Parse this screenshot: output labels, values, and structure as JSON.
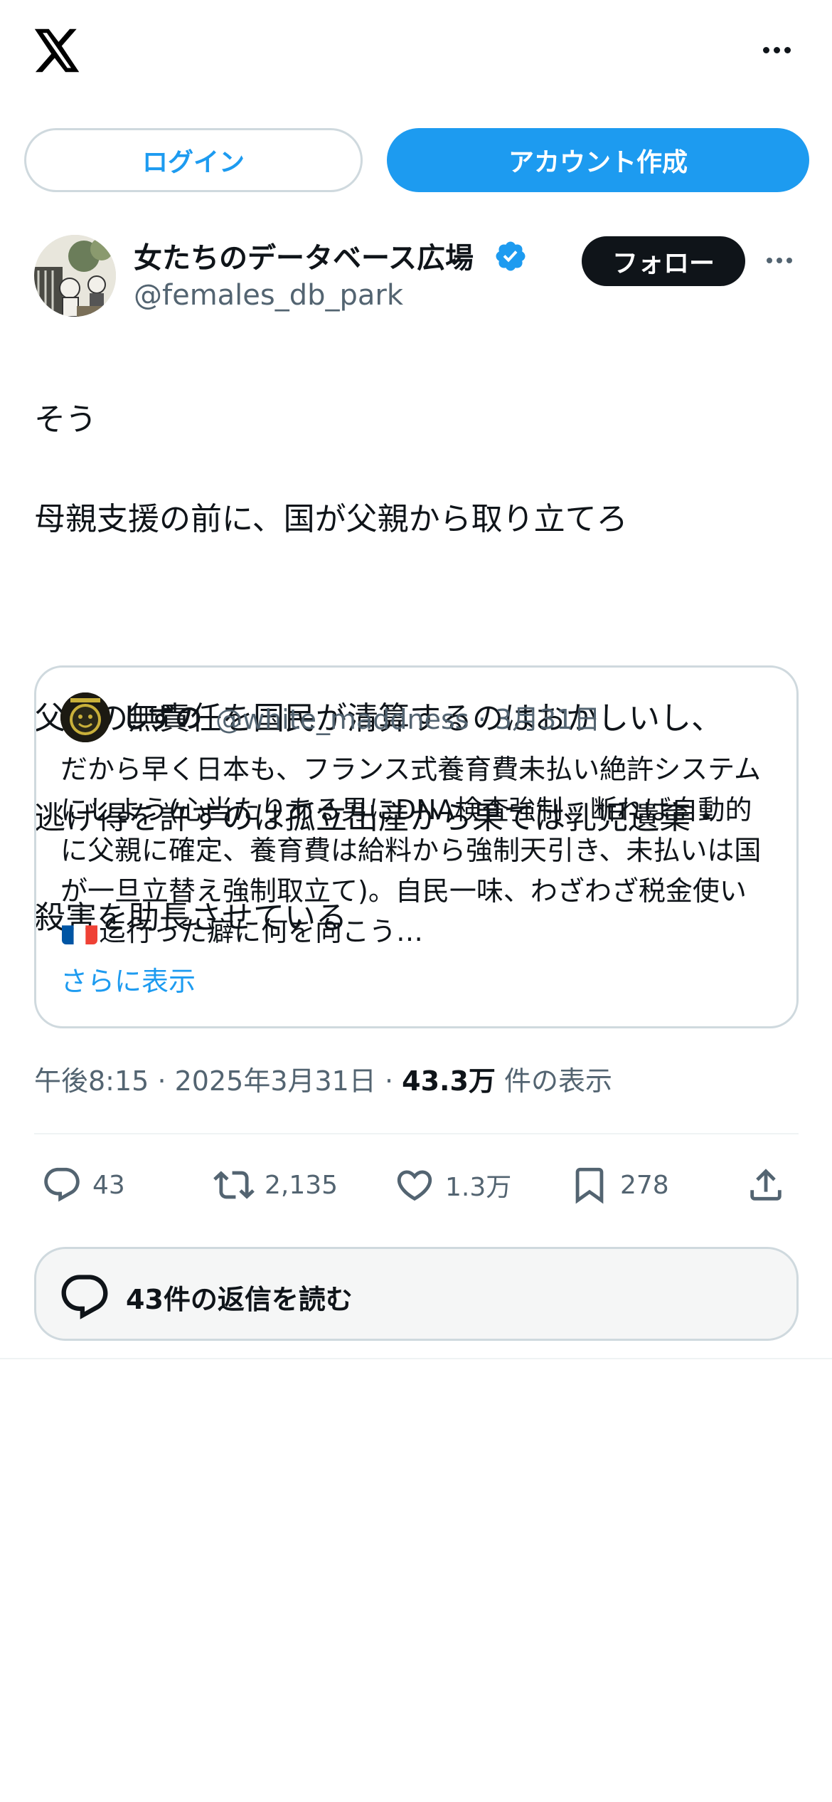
{
  "header": {
    "logo": "x-logo-icon",
    "more_icon": "more-horizontal-icon"
  },
  "auth": {
    "login_label": "ログイン",
    "signup_label": "アカウント作成"
  },
  "author": {
    "name": "女たちのデータベース広場",
    "handle": "@females_db_park",
    "verified_icon": "verified-badge-icon",
    "follow_label": "フォロー"
  },
  "tweet": {
    "line1": "そう",
    "line2": "母親支援の前に、国が父親から取り立てろ",
    "line3": "父親の無責任を国民が清算するのはおかしいし、",
    "line4": "逃げ得を許すのは孤立出産から果ては乳児遺棄・",
    "line5": "殺害を助長させている"
  },
  "quote": {
    "name": "しずの",
    "handle": "@white_maddness",
    "date": "3月31日",
    "separator": "·",
    "text_before_flag": "だから早く日本も、フランス式養育費未払い絶許システムにしよう(心当たりある男にDNA検査強制、断れば自動的に父親に確定、養育費は給料から強制天引き、未払いは国が一旦立替え強制取立て)。自民一味、わざわざ税金使い",
    "flag_icon": "france-flag-icon",
    "text_after_flag": "迄行った癖に何を向こう…",
    "show_more": "さらに表示"
  },
  "meta": {
    "time": "午後8:15",
    "date": "2025年3月31日",
    "separator": "·",
    "views_count": "43.3万",
    "views_label": "件の表示"
  },
  "actions": {
    "reply_count": "43",
    "retweet_count": "2,135",
    "like_count": "1.3万",
    "bookmark_count": "278"
  },
  "replies": {
    "label": "43件の返信を読む"
  },
  "colors": {
    "accent": "#1d9bf0",
    "text": "#0f1419",
    "secondary": "#536471",
    "border": "#cfd9de"
  }
}
